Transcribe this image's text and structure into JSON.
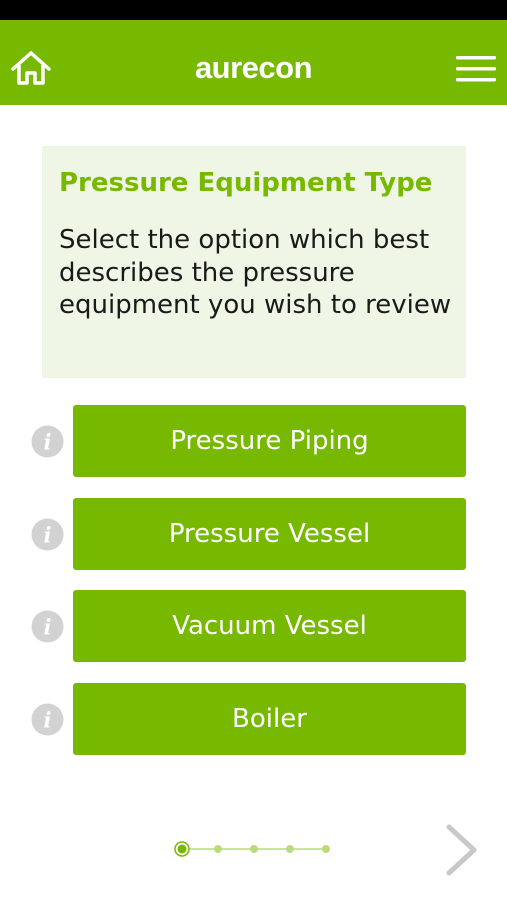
{
  "app": {
    "logo_text": "aurecon",
    "brand_color": "#77b900"
  },
  "header": {
    "home_icon": "home-icon",
    "menu_icon": "hamburger-menu-icon"
  },
  "panel": {
    "title": "Pressure Equipment Type",
    "description": "Select the option which best describes the pressure equipment you wish to review"
  },
  "options": [
    {
      "label": "Pressure Piping",
      "info_icon": "info-icon"
    },
    {
      "label": "Pressure Vessel",
      "info_icon": "info-icon"
    },
    {
      "label": "Vacuum Vessel",
      "info_icon": "info-icon"
    },
    {
      "label": "Boiler",
      "info_icon": "info-icon"
    }
  ],
  "pagination": {
    "total_steps": 5,
    "current_step": 1
  },
  "navigation": {
    "next_icon": "chevron-right-icon"
  }
}
